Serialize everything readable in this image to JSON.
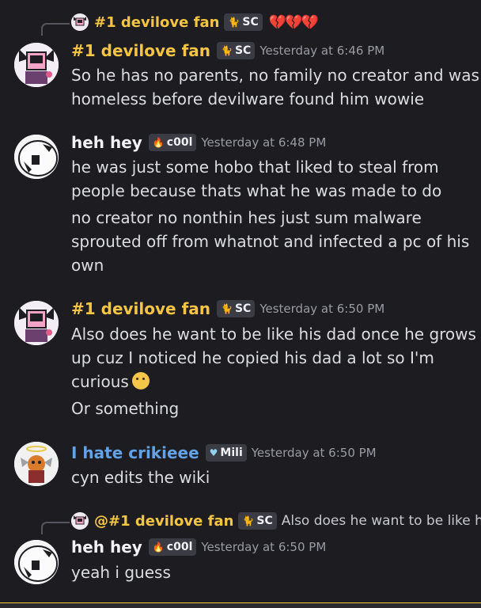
{
  "reply1": {
    "name": "#1 devilove fan",
    "tag_icon": "cat-icon",
    "tag": "SC",
    "hearts": "💔💔💔"
  },
  "messages": [
    {
      "name": "#1 devilove fan",
      "tag": "SC",
      "time": "Yesterday at 6:46 PM",
      "lines": [
        "So he has no parents, no family no creator and was",
        "homeless before devilware found him wowie"
      ]
    },
    {
      "name": "heh hey",
      "tag": "c00l",
      "time": "Yesterday at 6:48 PM",
      "lines": [
        "he was just some hobo that liked to steal from",
        "people because thats what he was made to do",
        "no creator no nonthin hes just sum malware",
        "sprouted off from whatnot and infected a pc of his",
        "own"
      ]
    },
    {
      "name": "#1 devilove fan",
      "tag": "SC",
      "time": "Yesterday at 6:50 PM",
      "lines": [
        "Also does he want to be like his dad once he grows",
        "up cuz I noticed he copied his dad a lot so I'm",
        "curious",
        "Or something"
      ]
    },
    {
      "name": "I hate crikieee",
      "tag": "Mili",
      "time": "Yesterday at 6:50 PM",
      "lines": [
        "cyn edits the wiki"
      ]
    },
    {
      "name": "heh hey",
      "tag": "c00l",
      "time": "Yesterday at 6:50 PM",
      "lines": [
        "yeah i guess"
      ]
    }
  ],
  "reply2": {
    "name": "@#1 devilove fan",
    "tag": "SC",
    "text": "Also does he want to be like his"
  },
  "colors": {
    "background": "#1c1c21",
    "gold_name": "#f5c542",
    "blue_name": "#62a3e8"
  }
}
